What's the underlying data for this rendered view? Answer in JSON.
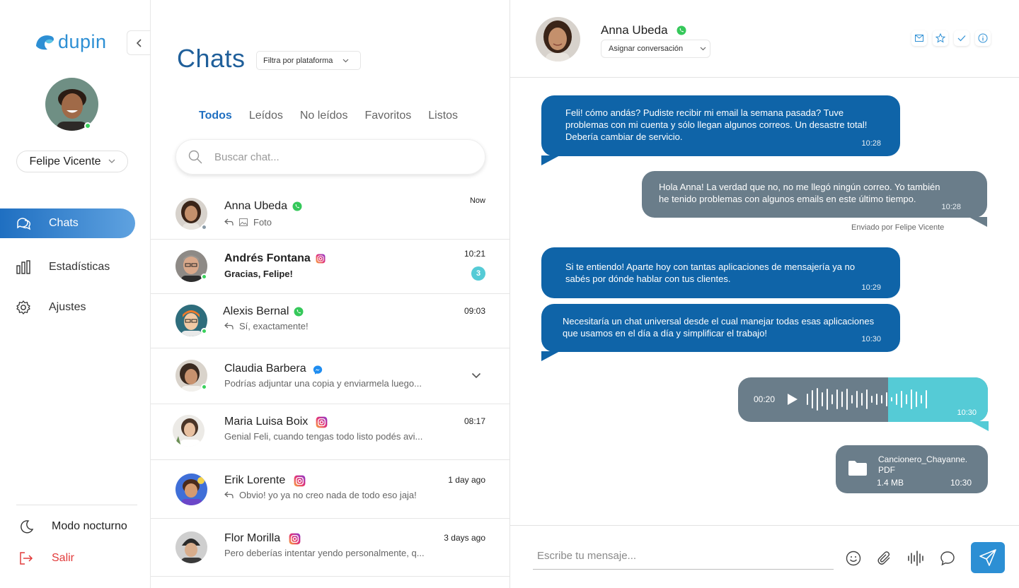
{
  "brand": {
    "name": "dupin",
    "color": "#2d8fd4"
  },
  "sidebar": {
    "user_name": "Felipe Vicente",
    "nav": [
      {
        "label": "Chats",
        "icon": "chats-icon",
        "active": true
      },
      {
        "label": "Estadísticas",
        "icon": "bar-chart-icon",
        "active": false
      },
      {
        "label": "Ajustes",
        "icon": "gear-icon",
        "active": false
      }
    ],
    "night_mode_label": "Modo nocturno",
    "logout_label": "Salir"
  },
  "chatlist": {
    "title": "Chats",
    "filter_label": "Filtra por plataforma",
    "tabs": [
      "Todos",
      "Leídos",
      "No leídos",
      "Favoritos",
      "Listos"
    ],
    "active_tab": "Todos",
    "search_placeholder": "Buscar chat...",
    "chats": [
      {
        "name": "Anna Ubeda",
        "platform": "whatsapp",
        "preview": "Foto",
        "time": "Now",
        "replied": true,
        "photo": true
      },
      {
        "name": "Andrés Fontana",
        "platform": "instagram",
        "preview": "Gracias, Felipe!",
        "time": "10:21",
        "unread": "3",
        "bold": true
      },
      {
        "name": "Alexis Bernal",
        "platform": "whatsapp",
        "preview": "Sí, exactamente!",
        "time": "09:03",
        "replied": true
      },
      {
        "name": "Claudia Barbera",
        "platform": "messenger",
        "preview": "Podrías adjuntar una copia y enviarmela luego...",
        "time": ""
      },
      {
        "name": "Maria Luisa Boix",
        "platform": "instagram",
        "preview": "Genial Feli, cuando tengas todo listo podés avi...",
        "time": "08:17"
      },
      {
        "name": "Erik Lorente",
        "platform": "instagram",
        "preview": "Obvio! yo ya no creo nada de todo eso jaja!",
        "time": "1 day ago",
        "replied": true
      },
      {
        "name": "Flor Morilla",
        "platform": "instagram",
        "preview": "Pero deberías intentar yendo personalmente, q...",
        "time": "3 days ago"
      }
    ]
  },
  "conversation": {
    "contact_name": "Anna Ubeda",
    "platform": "whatsapp",
    "assign_label": "Asignar conversación",
    "messages": [
      {
        "direction": "in",
        "text": "Feli! cómo andás? Pudiste recibir mi email la semana pasada? Tuve\nproblemas con mi cuenta y sólo llegan algunos correos. Un desastre total!\nDebería cambiar de servicio.",
        "time": "10:28"
      },
      {
        "direction": "out",
        "text": "Hola Anna! La verdad que no, no me llegó ningún correo. Yo también\nhe tenido problemas con algunos emails en este último tiempo.",
        "time": "10:28",
        "sent_by": "Enviado por Felipe Vicente"
      },
      {
        "direction": "in",
        "text": "Si te entiendo! Aparte hoy con tantas aplicaciones de mensajería ya no\nsabés por dónde hablar con tus clientes.",
        "time": "10:29"
      },
      {
        "direction": "in",
        "text": "Necesitaría un chat universal desde el cual manejar todas esas aplicaciones\nque usamos en el día a día y simplificar el trabajo!",
        "time": "10:30"
      }
    ],
    "audio": {
      "duration": "00:20",
      "time": "10:30",
      "progress": 0.6
    },
    "file": {
      "name": "Cancionero_Chayanne.",
      "ext": "PDF",
      "size": "1.4 MB",
      "time": "10:30"
    },
    "composer_placeholder": "Escribe tu mensaje..."
  }
}
